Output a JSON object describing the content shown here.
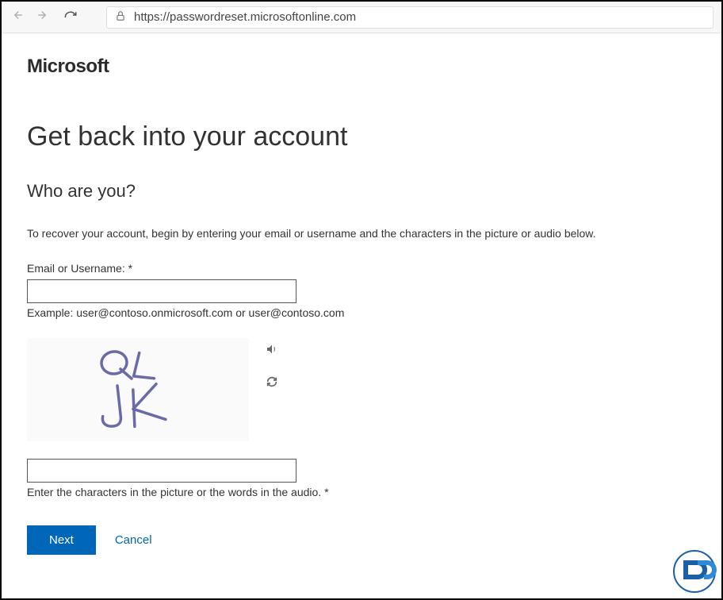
{
  "browser": {
    "url": "https://passwordreset.microsoftonline.com"
  },
  "header": {
    "brand": "Microsoft"
  },
  "page": {
    "title": "Get back into your account",
    "subtitle": "Who are you?",
    "instruction": "To recover your account, begin by entering your email or username and the characters in the picture or audio below."
  },
  "form": {
    "email_label": "Email or Username: *",
    "email_value": "",
    "email_example": "Example: user@contoso.onmicrosoft.com or user@contoso.com",
    "captcha_value": "",
    "captcha_help": "Enter the characters in the picture or the words in the audio. *",
    "captcha_text": "QLJK"
  },
  "buttons": {
    "next": "Next",
    "cancel": "Cancel"
  }
}
